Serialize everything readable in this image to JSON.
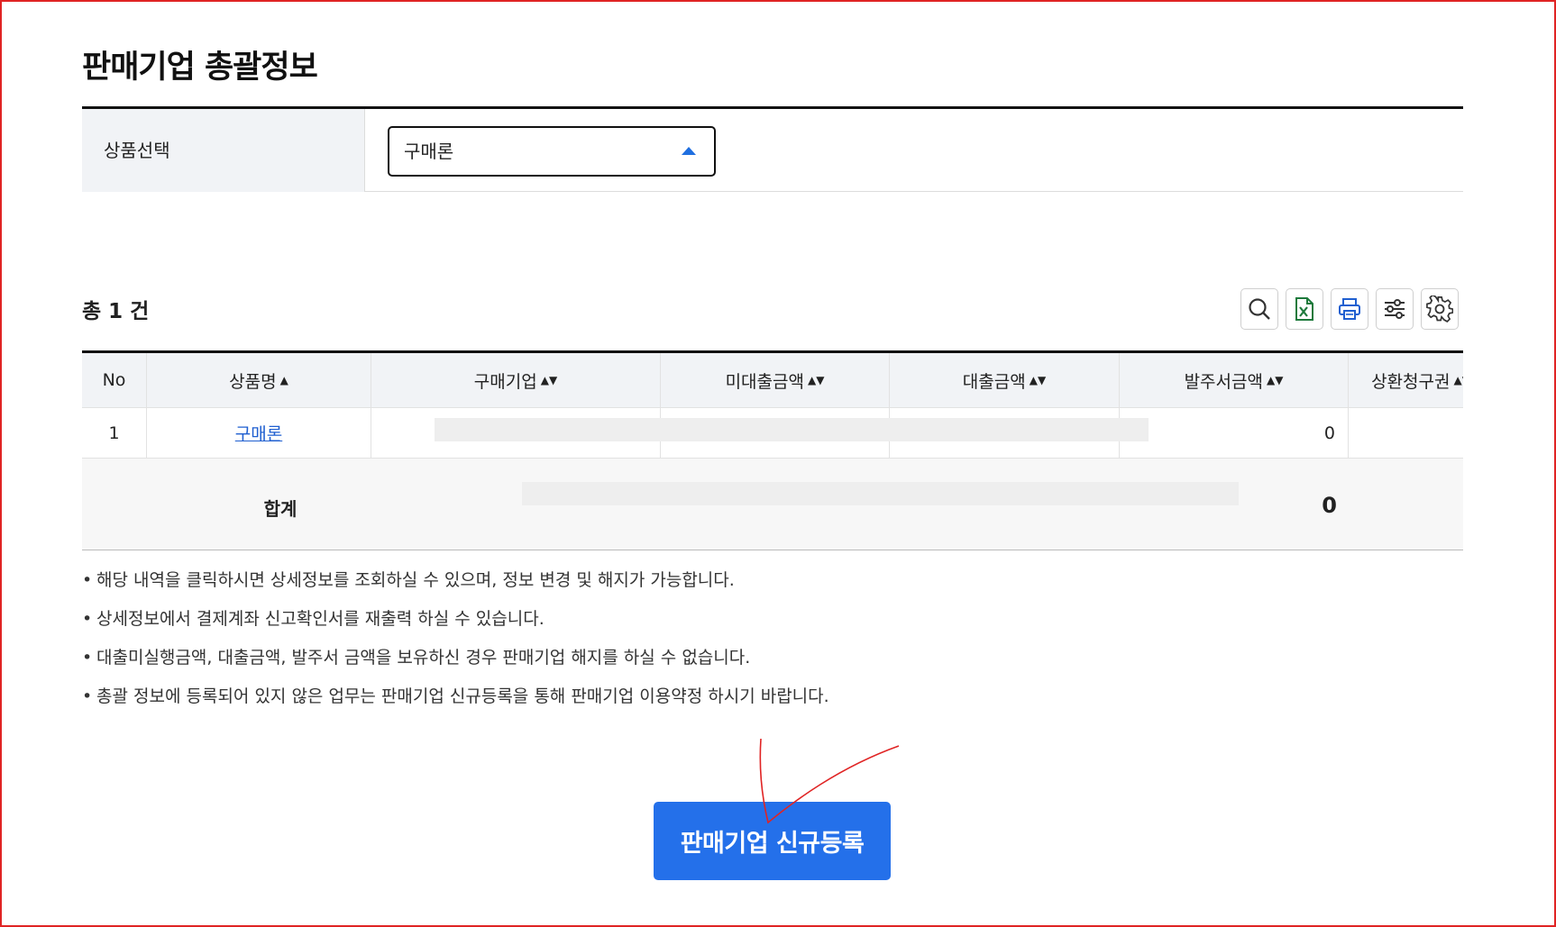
{
  "page": {
    "title": "판매기업 총괄정보"
  },
  "filter": {
    "label": "상품선택",
    "selected_product": "구매론"
  },
  "list": {
    "total": "총 1 건",
    "toolbar": [
      "search-icon",
      "excel-icon",
      "print-icon",
      "filter-settings-icon",
      "gear-icon"
    ],
    "columns": [
      {
        "label": "No",
        "sort": ""
      },
      {
        "label": "상품명",
        "sort": "▲"
      },
      {
        "label": "구매기업",
        "sort": "▲▼"
      },
      {
        "label": "미대출금액",
        "sort": "▲▼"
      },
      {
        "label": "대출금액",
        "sort": "▲▼"
      },
      {
        "label": "발주서금액",
        "sort": "▲▼"
      },
      {
        "label": "상환청구권",
        "sort": "▲▼"
      }
    ],
    "rows": [
      {
        "no": "1",
        "product": "구매론",
        "order_amount": "0"
      }
    ],
    "summary": {
      "label": "합계",
      "value": "0"
    }
  },
  "notes": [
    "해당 내역을 클릭하시면 상세정보를 조회하실 수 있으며, 정보 변경 및 해지가 가능합니다.",
    "상세정보에서 결제계좌 신고확인서를 재출력 하실 수 있습니다.",
    "대출미실행금액, 대출금액, 발주서 금액을 보유하신 경우 판매기업 해지를 하실 수 없습니다.",
    "총괄 정보에 등록되어 있지 않은 업무는 판매기업 신규등록을 통해 판매기업 이용약정 하시기 바랍니다."
  ],
  "actions": {
    "register_button": "판매기업 신규등록"
  },
  "colors": {
    "primary": "#2470ea",
    "link": "#1f5fd0",
    "annotation": "#e02424"
  }
}
